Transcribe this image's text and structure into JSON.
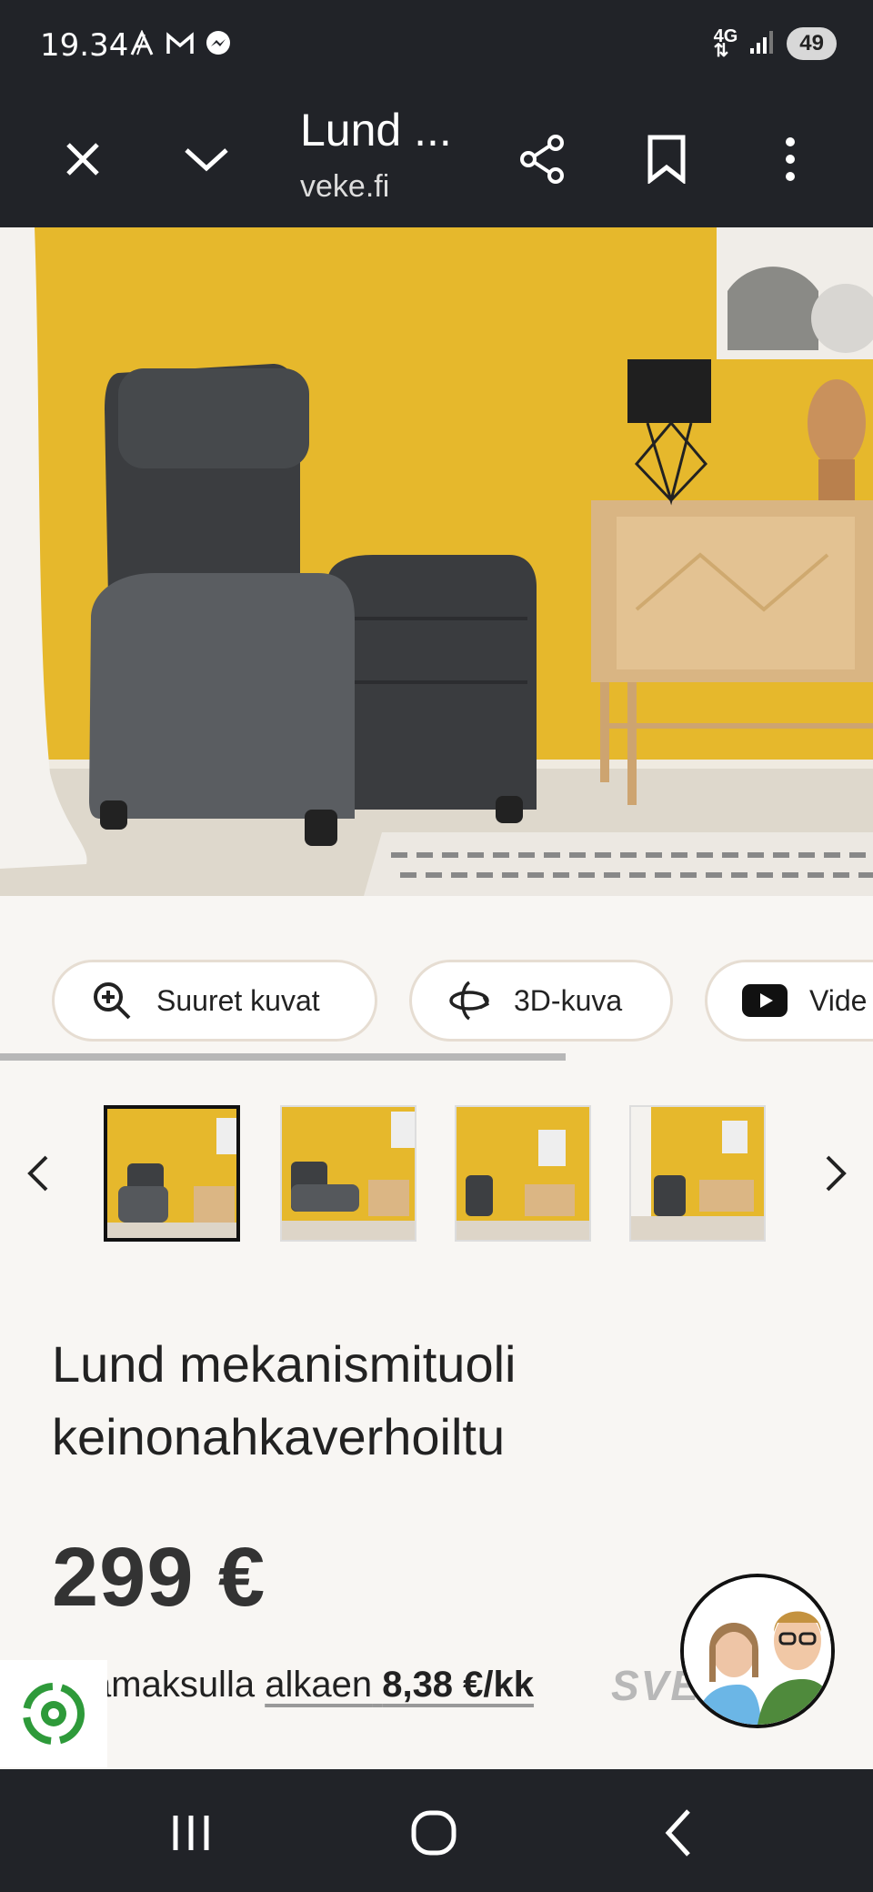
{
  "status": {
    "time": "19.34",
    "network": "4G",
    "battery": "49"
  },
  "browser": {
    "title": "Lund ...",
    "url": "veke.fi"
  },
  "gallery": {
    "chips": [
      {
        "label": "Suuret kuvat",
        "icon": "zoom-in-icon"
      },
      {
        "label": "3D-kuva",
        "icon": "rotate-3d-icon"
      },
      {
        "label": "Vide",
        "icon": "youtube-icon"
      }
    ],
    "thumbnail_count": 4,
    "active_thumbnail": 1
  },
  "product": {
    "title": "Lund mekanismituoli keinonahkaverhoiltu",
    "price": "299 €",
    "financing_prefix": "ämaksulla",
    "financing_link": "alkaen",
    "financing_amount": "8,38 €/kk",
    "partner_logo": "SVEA"
  },
  "colors": {
    "toolbar": "#212328",
    "wall": "#e8b828",
    "background": "#f8f6f3"
  }
}
